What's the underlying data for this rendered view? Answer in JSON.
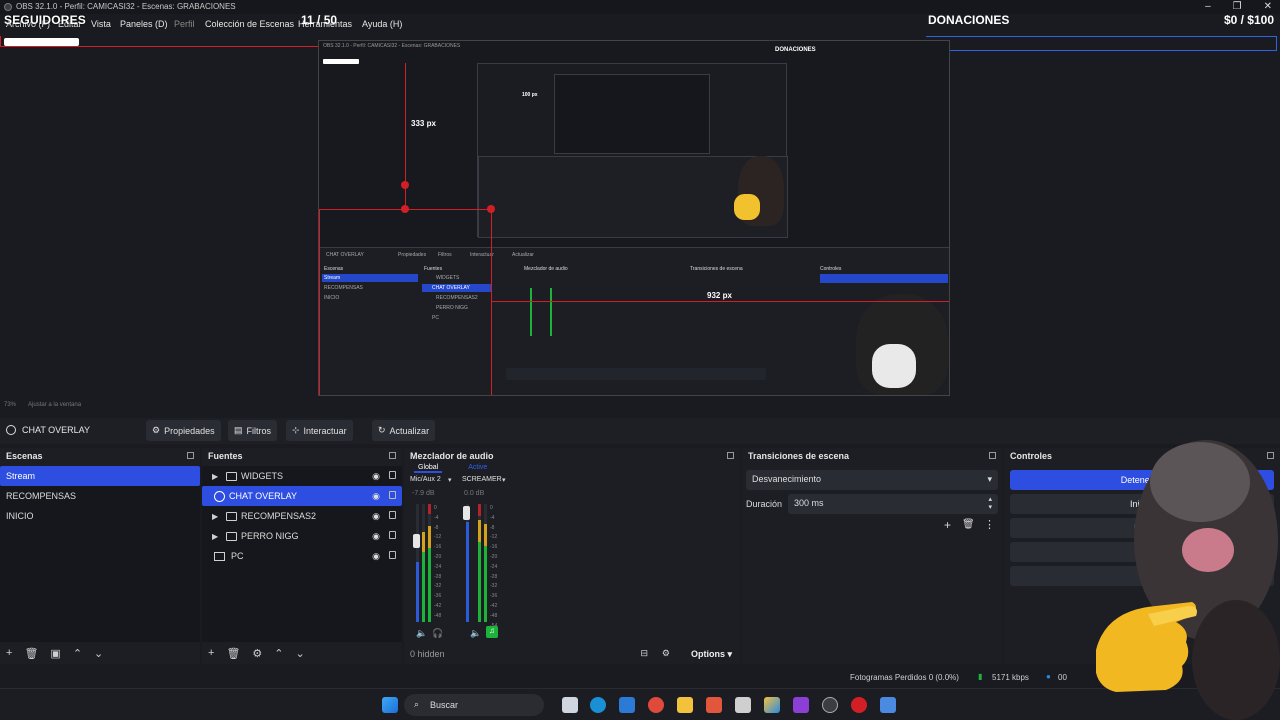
{
  "window": {
    "title": "OBS 32.1.0 - Perfil: CAMICASI32 - Escenas: GRABACIONES",
    "controls": [
      "–",
      "❐",
      "✕"
    ]
  },
  "menu": [
    "Archivo (F)",
    "Editar",
    "Vista",
    "Paneles (D)",
    "Perfil",
    "Colección de Escenas",
    "Herramientas",
    "Ayuda (H)"
  ],
  "overlay": {
    "followers_label": "SEGUIDORES",
    "followers_count": "11 / 50",
    "donations_label": "DONACIONES",
    "donations_count": "$0 / $100"
  },
  "preview": {
    "dim_vertical": "333 px",
    "dim_horizontal": "932 px",
    "nested_small": "100 px",
    "zoom_label": "73%",
    "zoom_mode": "Ajustar a la ventana",
    "nested_title": "OBS 32.1.0 - Perfil: CAMICASI32 - Escenas: GRABACIONES",
    "nested_donations": "DONACIONES",
    "nested_scenes": [
      "Stream",
      "RECOMPENSAS",
      "INICIO"
    ],
    "nested_sources": [
      "WIDGETS",
      "CHAT OVERLAY",
      "RECOMPENSAS2",
      "PERRO NIGG",
      "PC"
    ],
    "nested_headers": [
      "Escenas",
      "Fuentes",
      "Mezclador de audio",
      "Transiciones de escena",
      "Controles"
    ],
    "nested_buttons": [
      "CHAT OVERLAY",
      "Propiedades",
      "Filtros",
      "Interactuar",
      "Actualizar"
    ]
  },
  "toolbar": {
    "source": "CHAT OVERLAY",
    "properties": "Propiedades",
    "filters": "Filtros",
    "interact": "Interactuar",
    "refresh": "Actualizar"
  },
  "scenes": {
    "header": "Escenas",
    "items": [
      "Stream",
      "RECOMPENSAS",
      "INICIO"
    ]
  },
  "sources": {
    "header": "Fuentes",
    "items": [
      {
        "name": "WIDGETS",
        "type": "folder"
      },
      {
        "name": "CHAT OVERLAY",
        "type": "browser"
      },
      {
        "name": "RECOMPENSAS2",
        "type": "folder"
      },
      {
        "name": "PERRO NIGG",
        "type": "folder"
      },
      {
        "name": "PC",
        "type": "display"
      }
    ]
  },
  "mixer": {
    "header": "Mezclador de audio",
    "tab_global": "Global",
    "tab_active": "Active",
    "channels": [
      {
        "name": "Mic/Aux 2",
        "db": "-7.9 dB"
      },
      {
        "name": "SCREAMER",
        "db": "0.0 dB"
      }
    ],
    "scale": [
      "0",
      "-4",
      "-8",
      "-12",
      "-16",
      "-20",
      "-24",
      "-28",
      "-32",
      "-36",
      "-42",
      "-48",
      "-54",
      "-60"
    ],
    "hidden": "0 hidden",
    "options": "Options"
  },
  "transitions": {
    "header": "Transiciones de escena",
    "selected": "Desvanecimiento",
    "duration_label": "Duración",
    "duration_value": "300 ms"
  },
  "controls": {
    "header": "Controles",
    "buttons": [
      "Detener Tr",
      "Iniciar",
      "Inici",
      "",
      ""
    ]
  },
  "status": {
    "dropped": "Fotogramas Perdidos 0 (0.0%)",
    "bitrate": "5171 kbps",
    "extra": "00"
  },
  "taskbar": {
    "search": "Buscar"
  },
  "colors": {
    "accent": "#2d4ee0",
    "record_red": "#d21f26",
    "meter_green": "#1db33a"
  }
}
